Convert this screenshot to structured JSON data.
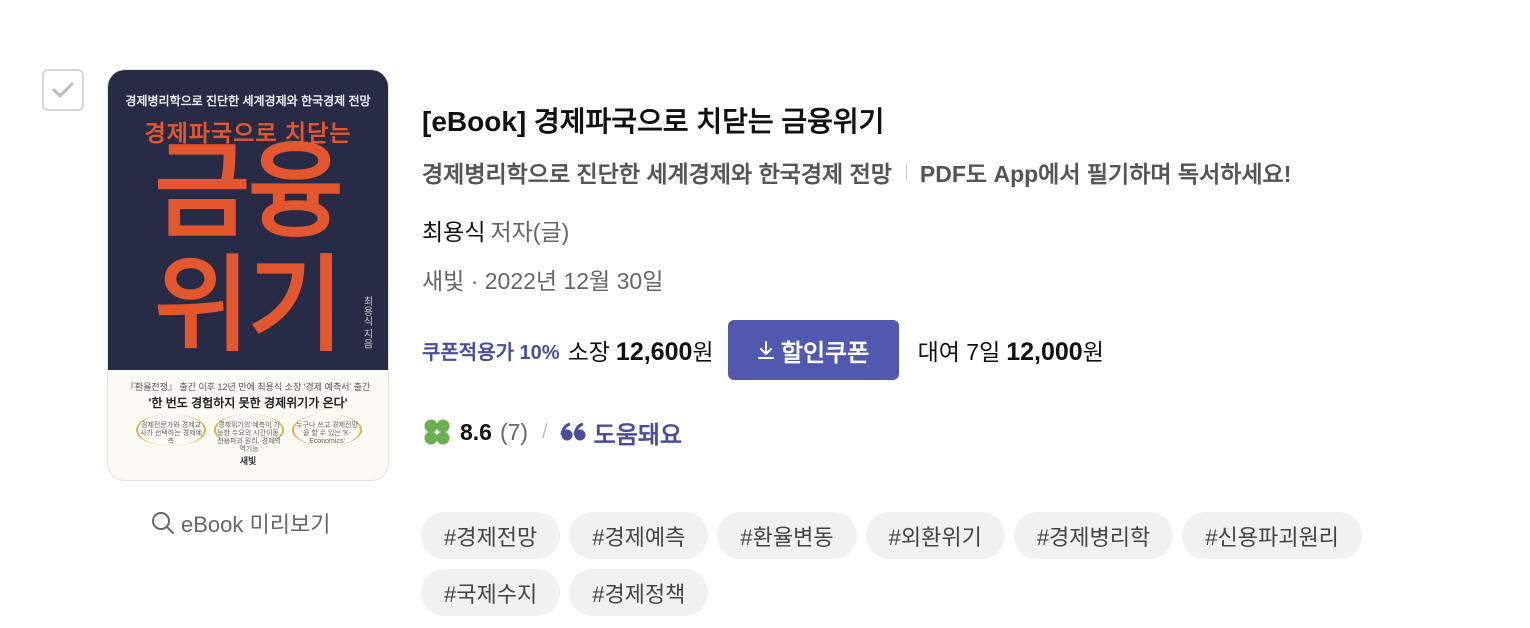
{
  "select_checkbox": {
    "checked": false
  },
  "cover": {
    "subtitle": "경제병리학으로 진단한 세계경제와 한국경제 전망",
    "title_small": "경제파국으로 치닫는",
    "title_big_line1": "금융",
    "title_big_line2": "위기",
    "author_vertical": "최용식 지음",
    "promo_line1": "『환율전쟁』 출간 이후 12년 만에 최용식 소장 '경제 예측서' 출간",
    "promo_line2": "'한 번도 경험하지 못한 경제위기가 온다'",
    "badges": [
      "경제전문가와 경제교사가 선택하는 경제예측",
      "경제위기의 예측이 가능한 수요의 시간이동, 신용파괴 원리, 경제의 역기능",
      "누구나 쓰고 경제전망을 할 수 있는 'K-Economics'"
    ],
    "publisher": "새빛"
  },
  "preview": {
    "label": "eBook 미리보기",
    "icon": "search-icon"
  },
  "book": {
    "title": "[eBook]  경제파국으로 치닫는 금융위기",
    "subtitle": "경제병리학으로 진단한 세계경제와 한국경제 전망",
    "note": "PDF도 App에서 필기하며 독서하세요!",
    "author_name": "최용식",
    "author_role": "저자(글)",
    "publisher_date": "새빛 · 2022년 12월 30일"
  },
  "price": {
    "coupon_label": "쿠폰적용가 10%",
    "own_label": "소장",
    "own_price": "12,600",
    "currency": "원",
    "coupon_button": "할인쿠폰",
    "rent_label": "대여 7일",
    "rent_price": "12,000"
  },
  "rating": {
    "score": "8.6",
    "count": "(7)",
    "separator": "/",
    "helpful_label": "도움돼요"
  },
  "tags": [
    "#경제전망",
    "#경제예측",
    "#환율변동",
    "#외환위기",
    "#경제병리학",
    "#신용파괴원리",
    "#국제수지",
    "#경제정책"
  ],
  "colors": {
    "accent": "#5058b0",
    "accent_text": "#4a4d9c",
    "clover": "#6bb04e",
    "cover_bg": "#272b45",
    "cover_title": "#e4572e"
  }
}
